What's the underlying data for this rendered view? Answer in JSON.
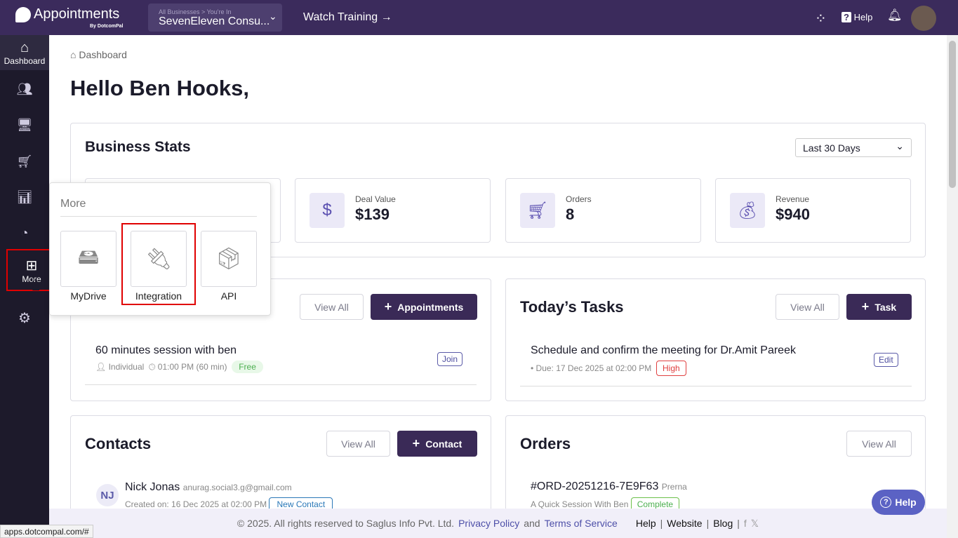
{
  "header": {
    "app_name": "Appointments",
    "app_sub": "By DotcomPal",
    "business_label": "All Businesses > You're In",
    "business_name": "SevenEleven Consu...",
    "watch_training": "Watch Training →",
    "help": "Help"
  },
  "sidebar": {
    "items": [
      {
        "label": "Dashboard",
        "icon": "home-icon"
      },
      {
        "label": "",
        "icon": "contacts-icon"
      },
      {
        "label": "",
        "icon": "monitor-icon"
      },
      {
        "label": "",
        "icon": "cart-icon"
      },
      {
        "label": "",
        "icon": "chart-icon"
      },
      {
        "label": "",
        "icon": "gauge-icon"
      },
      {
        "label": "More",
        "icon": "grid-plus-icon"
      },
      {
        "label": "",
        "icon": "gear-icon"
      }
    ]
  },
  "breadcrumb": "Dashboard",
  "greeting": "Hello Ben Hooks,",
  "stats": {
    "title": "Business Stats",
    "range": "Last 30 Days",
    "items": [
      {
        "label": "Deal Value",
        "value": "$139",
        "icon": "money-hand-icon"
      },
      {
        "label": "Orders",
        "value": "8",
        "icon": "cart-icon"
      },
      {
        "label": "Revenue",
        "value": "$940",
        "icon": "money-bag-icon"
      }
    ]
  },
  "more_menu": {
    "title": "More",
    "items": [
      {
        "label": "MyDrive",
        "icon": "drive-icon"
      },
      {
        "label": "Integration",
        "icon": "plug-icon"
      },
      {
        "label": "API",
        "icon": "box-icon"
      }
    ]
  },
  "appointments": {
    "view_all": "View All",
    "add": "Appointments",
    "item": {
      "title": "60 minutes session with ben",
      "type": "Individual",
      "time": "01:00 PM (60 min)",
      "price": "Free",
      "action": "Join"
    }
  },
  "tasks": {
    "title": "Today’s Tasks",
    "view_all": "View All",
    "add": "Task",
    "item": {
      "title": "Schedule and confirm the meeting for Dr.Amit Pareek",
      "due": "• Due: 17 Dec 2025 at 02:00 PM",
      "priority": "High",
      "action": "Edit"
    }
  },
  "contacts": {
    "title": "Contacts",
    "view_all": "View All",
    "add": "Contact",
    "item": {
      "initials": "NJ",
      "name": "Nick Jonas",
      "email": "anurag.social3.g@gmail.com",
      "created": "Created on: 16 Dec 2025 at 02:00 PM",
      "tag": "New Contact"
    }
  },
  "orders": {
    "title": "Orders",
    "view_all": "View All",
    "item": {
      "id": "#ORD-20251216-7E9F63",
      "customer": "Prerna",
      "product": "A Quick Session With Ben",
      "status": "Complete"
    }
  },
  "footer": {
    "copyright": "©  2025. All rights reserved to Saglus Info Pvt. Ltd.",
    "privacy": "Privacy Policy",
    "and": "and",
    "terms": "Terms of Service",
    "help": "Help",
    "website": "Website",
    "blog": "Blog"
  },
  "help_fab": "Help",
  "status_url": "apps.dotcompal.com/#",
  "colors": {
    "header": "#3b2b5c",
    "sidebar": "#1d1a2b",
    "primary": "#3a2a57",
    "highlight": "#e00000"
  }
}
